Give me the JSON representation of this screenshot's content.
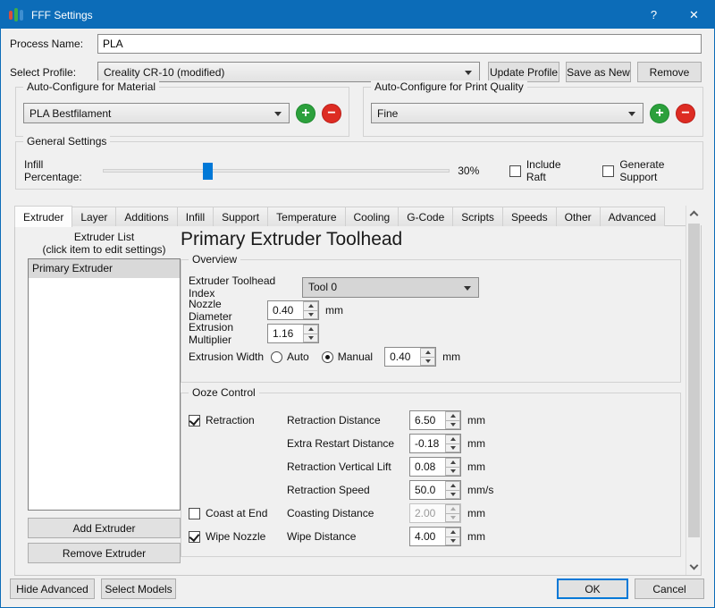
{
  "window": {
    "title": "FFF Settings",
    "help_label": "?",
    "close_label": "✕",
    "titlebar_color": "#0c6cb8"
  },
  "colors": {
    "accent_blue": "#0c6cb8",
    "default_button_border": "#0078d7",
    "slider_handle": "#0078d7",
    "add_green": "#2ca03c",
    "remove_red": "#dd2c23"
  },
  "header": {
    "process_name_label": "Process Name:",
    "process_name_value": "PLA",
    "select_profile_label": "Select Profile:",
    "profile_value": "Creality CR-10 (modified)",
    "update_profile_button": "Update Profile",
    "save_as_new_button": "Save as New",
    "remove_button": "Remove"
  },
  "auto_configure": {
    "material": {
      "title": "Auto-Configure for Material",
      "value": "PLA Bestfilament",
      "add_label": "+",
      "remove_label": "−"
    },
    "quality": {
      "title": "Auto-Configure for Print Quality",
      "value": "Fine",
      "add_label": "+",
      "remove_label": "−"
    }
  },
  "general_settings": {
    "title": "General Settings",
    "infill_label": "Infill Percentage:",
    "infill_value_text": "30%",
    "infill_percent": 30,
    "include_raft_label": "Include Raft",
    "include_raft_checked": false,
    "generate_support_label": "Generate Support",
    "generate_support_checked": false
  },
  "tabs": [
    "Extruder",
    "Layer",
    "Additions",
    "Infill",
    "Support",
    "Temperature",
    "Cooling",
    "G-Code",
    "Scripts",
    "Speeds",
    "Other",
    "Advanced"
  ],
  "active_tab": "Extruder",
  "extruder_panel": {
    "list_title": "Extruder List",
    "list_subtitle": "(click item to edit settings)",
    "list_items": [
      "Primary Extruder"
    ],
    "add_button": "Add Extruder",
    "remove_button": "Remove Extruder",
    "heading": "Primary Extruder Toolhead",
    "overview": {
      "title": "Overview",
      "toolhead_index_label": "Extruder Toolhead Index",
      "toolhead_index_value": "Tool 0",
      "nozzle_diameter_label": "Nozzle Diameter",
      "nozzle_diameter_value": "0.40",
      "nozzle_diameter_unit": "mm",
      "extrusion_multiplier_label": "Extrusion Multiplier",
      "extrusion_multiplier_value": "1.16",
      "extrusion_width_label": "Extrusion Width",
      "auto_label": "Auto",
      "auto_selected": false,
      "manual_label": "Manual",
      "manual_selected": true,
      "extrusion_width_value": "0.40",
      "extrusion_width_unit": "mm"
    },
    "ooze_control": {
      "title": "Ooze Control",
      "retraction_label": "Retraction",
      "retraction_checked": true,
      "coast_label": "Coast at End",
      "coast_checked": false,
      "wipe_label": "Wipe Nozzle",
      "wipe_checked": true,
      "rows": [
        {
          "label": "Retraction Distance",
          "value": "6.50",
          "unit": "mm"
        },
        {
          "label": "Extra Restart Distance",
          "value": "-0.18",
          "unit": "mm"
        },
        {
          "label": "Retraction Vertical Lift",
          "value": "0.08",
          "unit": "mm"
        },
        {
          "label": "Retraction Speed",
          "value": "50.0",
          "unit": "mm/s"
        },
        {
          "label": "Coasting Distance",
          "value": "2.00",
          "unit": "mm"
        },
        {
          "label": "Wipe Distance",
          "value": "4.00",
          "unit": "mm"
        }
      ]
    }
  },
  "footer": {
    "hide_advanced_button": "Hide Advanced",
    "select_models_button": "Select Models",
    "ok_button": "OK",
    "cancel_button": "Cancel"
  }
}
